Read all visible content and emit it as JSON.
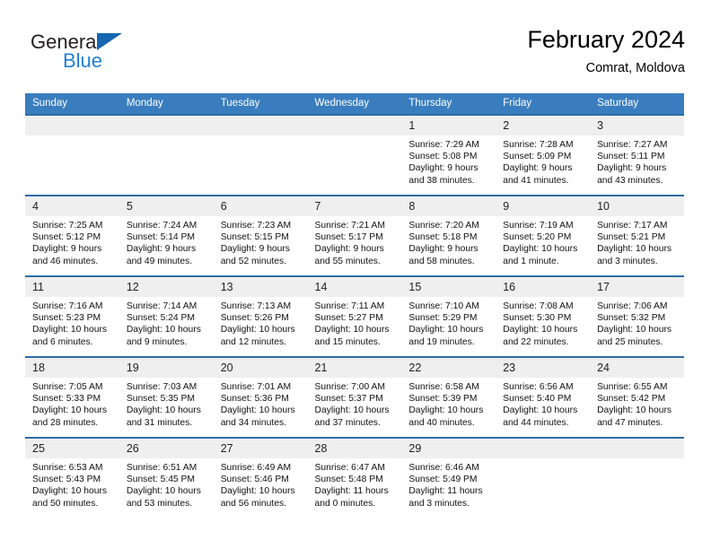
{
  "brand": {
    "name_part1": "General",
    "name_part2": "Blue",
    "accent_color": "#1f7fd4",
    "flag_color": "#1567b2"
  },
  "header": {
    "title": "February 2024",
    "location": "Comrat, Moldova"
  },
  "calendar": {
    "header_bg": "#3a7dbf",
    "row_border_color": "#2e6da4",
    "daynum_bg": "#efefef",
    "weekdays": [
      "Sunday",
      "Monday",
      "Tuesday",
      "Wednesday",
      "Thursday",
      "Friday",
      "Saturday"
    ],
    "weeks": [
      [
        {
          "day": "",
          "sunrise": "",
          "sunset": "",
          "daylight_1": "",
          "daylight_2": "",
          "empty": true
        },
        {
          "day": "",
          "sunrise": "",
          "sunset": "",
          "daylight_1": "",
          "daylight_2": "",
          "empty": true
        },
        {
          "day": "",
          "sunrise": "",
          "sunset": "",
          "daylight_1": "",
          "daylight_2": "",
          "empty": true
        },
        {
          "day": "",
          "sunrise": "",
          "sunset": "",
          "daylight_1": "",
          "daylight_2": "",
          "empty": true
        },
        {
          "day": "1",
          "sunrise": "Sunrise: 7:29 AM",
          "sunset": "Sunset: 5:08 PM",
          "daylight_1": "Daylight: 9 hours",
          "daylight_2": "and 38 minutes."
        },
        {
          "day": "2",
          "sunrise": "Sunrise: 7:28 AM",
          "sunset": "Sunset: 5:09 PM",
          "daylight_1": "Daylight: 9 hours",
          "daylight_2": "and 41 minutes."
        },
        {
          "day": "3",
          "sunrise": "Sunrise: 7:27 AM",
          "sunset": "Sunset: 5:11 PM",
          "daylight_1": "Daylight: 9 hours",
          "daylight_2": "and 43 minutes."
        }
      ],
      [
        {
          "day": "4",
          "sunrise": "Sunrise: 7:25 AM",
          "sunset": "Sunset: 5:12 PM",
          "daylight_1": "Daylight: 9 hours",
          "daylight_2": "and 46 minutes."
        },
        {
          "day": "5",
          "sunrise": "Sunrise: 7:24 AM",
          "sunset": "Sunset: 5:14 PM",
          "daylight_1": "Daylight: 9 hours",
          "daylight_2": "and 49 minutes."
        },
        {
          "day": "6",
          "sunrise": "Sunrise: 7:23 AM",
          "sunset": "Sunset: 5:15 PM",
          "daylight_1": "Daylight: 9 hours",
          "daylight_2": "and 52 minutes."
        },
        {
          "day": "7",
          "sunrise": "Sunrise: 7:21 AM",
          "sunset": "Sunset: 5:17 PM",
          "daylight_1": "Daylight: 9 hours",
          "daylight_2": "and 55 minutes."
        },
        {
          "day": "8",
          "sunrise": "Sunrise: 7:20 AM",
          "sunset": "Sunset: 5:18 PM",
          "daylight_1": "Daylight: 9 hours",
          "daylight_2": "and 58 minutes."
        },
        {
          "day": "9",
          "sunrise": "Sunrise: 7:19 AM",
          "sunset": "Sunset: 5:20 PM",
          "daylight_1": "Daylight: 10 hours",
          "daylight_2": "and 1 minute."
        },
        {
          "day": "10",
          "sunrise": "Sunrise: 7:17 AM",
          "sunset": "Sunset: 5:21 PM",
          "daylight_1": "Daylight: 10 hours",
          "daylight_2": "and 3 minutes."
        }
      ],
      [
        {
          "day": "11",
          "sunrise": "Sunrise: 7:16 AM",
          "sunset": "Sunset: 5:23 PM",
          "daylight_1": "Daylight: 10 hours",
          "daylight_2": "and 6 minutes."
        },
        {
          "day": "12",
          "sunrise": "Sunrise: 7:14 AM",
          "sunset": "Sunset: 5:24 PM",
          "daylight_1": "Daylight: 10 hours",
          "daylight_2": "and 9 minutes."
        },
        {
          "day": "13",
          "sunrise": "Sunrise: 7:13 AM",
          "sunset": "Sunset: 5:26 PM",
          "daylight_1": "Daylight: 10 hours",
          "daylight_2": "and 12 minutes."
        },
        {
          "day": "14",
          "sunrise": "Sunrise: 7:11 AM",
          "sunset": "Sunset: 5:27 PM",
          "daylight_1": "Daylight: 10 hours",
          "daylight_2": "and 15 minutes."
        },
        {
          "day": "15",
          "sunrise": "Sunrise: 7:10 AM",
          "sunset": "Sunset: 5:29 PM",
          "daylight_1": "Daylight: 10 hours",
          "daylight_2": "and 19 minutes."
        },
        {
          "day": "16",
          "sunrise": "Sunrise: 7:08 AM",
          "sunset": "Sunset: 5:30 PM",
          "daylight_1": "Daylight: 10 hours",
          "daylight_2": "and 22 minutes."
        },
        {
          "day": "17",
          "sunrise": "Sunrise: 7:06 AM",
          "sunset": "Sunset: 5:32 PM",
          "daylight_1": "Daylight: 10 hours",
          "daylight_2": "and 25 minutes."
        }
      ],
      [
        {
          "day": "18",
          "sunrise": "Sunrise: 7:05 AM",
          "sunset": "Sunset: 5:33 PM",
          "daylight_1": "Daylight: 10 hours",
          "daylight_2": "and 28 minutes."
        },
        {
          "day": "19",
          "sunrise": "Sunrise: 7:03 AM",
          "sunset": "Sunset: 5:35 PM",
          "daylight_1": "Daylight: 10 hours",
          "daylight_2": "and 31 minutes."
        },
        {
          "day": "20",
          "sunrise": "Sunrise: 7:01 AM",
          "sunset": "Sunset: 5:36 PM",
          "daylight_1": "Daylight: 10 hours",
          "daylight_2": "and 34 minutes."
        },
        {
          "day": "21",
          "sunrise": "Sunrise: 7:00 AM",
          "sunset": "Sunset: 5:37 PM",
          "daylight_1": "Daylight: 10 hours",
          "daylight_2": "and 37 minutes."
        },
        {
          "day": "22",
          "sunrise": "Sunrise: 6:58 AM",
          "sunset": "Sunset: 5:39 PM",
          "daylight_1": "Daylight: 10 hours",
          "daylight_2": "and 40 minutes."
        },
        {
          "day": "23",
          "sunrise": "Sunrise: 6:56 AM",
          "sunset": "Sunset: 5:40 PM",
          "daylight_1": "Daylight: 10 hours",
          "daylight_2": "and 44 minutes."
        },
        {
          "day": "24",
          "sunrise": "Sunrise: 6:55 AM",
          "sunset": "Sunset: 5:42 PM",
          "daylight_1": "Daylight: 10 hours",
          "daylight_2": "and 47 minutes."
        }
      ],
      [
        {
          "day": "25",
          "sunrise": "Sunrise: 6:53 AM",
          "sunset": "Sunset: 5:43 PM",
          "daylight_1": "Daylight: 10 hours",
          "daylight_2": "and 50 minutes."
        },
        {
          "day": "26",
          "sunrise": "Sunrise: 6:51 AM",
          "sunset": "Sunset: 5:45 PM",
          "daylight_1": "Daylight: 10 hours",
          "daylight_2": "and 53 minutes."
        },
        {
          "day": "27",
          "sunrise": "Sunrise: 6:49 AM",
          "sunset": "Sunset: 5:46 PM",
          "daylight_1": "Daylight: 10 hours",
          "daylight_2": "and 56 minutes."
        },
        {
          "day": "28",
          "sunrise": "Sunrise: 6:47 AM",
          "sunset": "Sunset: 5:48 PM",
          "daylight_1": "Daylight: 11 hours",
          "daylight_2": "and 0 minutes."
        },
        {
          "day": "29",
          "sunrise": "Sunrise: 6:46 AM",
          "sunset": "Sunset: 5:49 PM",
          "daylight_1": "Daylight: 11 hours",
          "daylight_2": "and 3 minutes."
        },
        {
          "day": "",
          "sunrise": "",
          "sunset": "",
          "daylight_1": "",
          "daylight_2": "",
          "empty": true
        },
        {
          "day": "",
          "sunrise": "",
          "sunset": "",
          "daylight_1": "",
          "daylight_2": "",
          "empty": true
        }
      ]
    ]
  }
}
